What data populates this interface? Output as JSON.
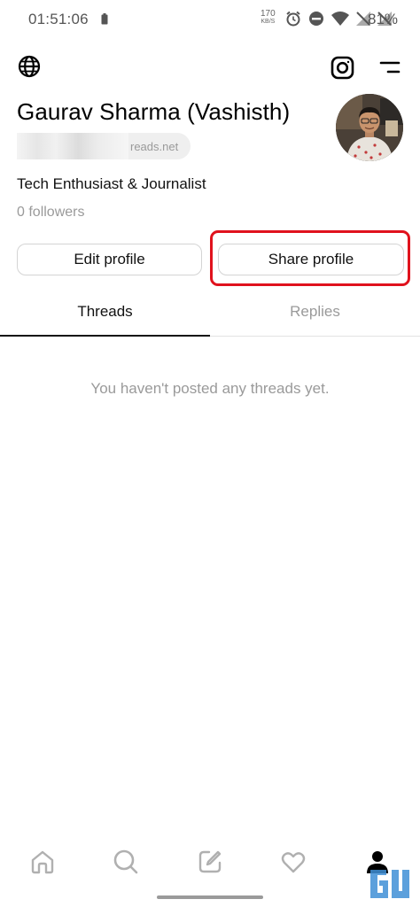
{
  "status_bar": {
    "time": "01:51:06",
    "net_speed_value": "170",
    "net_speed_unit": "KB/S",
    "battery_percent": "81%"
  },
  "header": {
    "globe_icon": "globe-icon",
    "instagram_icon": "instagram-icon",
    "menu_icon": "menu-icon"
  },
  "profile": {
    "name": "Gaurav Sharma (Vashisth)",
    "handle_suffix": "reads.net",
    "bio": "Tech Enthusiast & Journalist",
    "followers": "0 followers"
  },
  "actions": {
    "edit_label": "Edit profile",
    "share_label": "Share profile"
  },
  "tabs": [
    {
      "label": "Threads",
      "active": true
    },
    {
      "label": "Replies",
      "active": false
    }
  ],
  "empty_state": "You haven't posted any threads yet.",
  "bottom_nav": [
    "home-icon",
    "search-icon",
    "compose-icon",
    "heart-icon",
    "profile-icon"
  ],
  "colors": {
    "highlight": "#e0121d",
    "muted_text": "#9a9a9a",
    "primary_text": "#111111"
  }
}
